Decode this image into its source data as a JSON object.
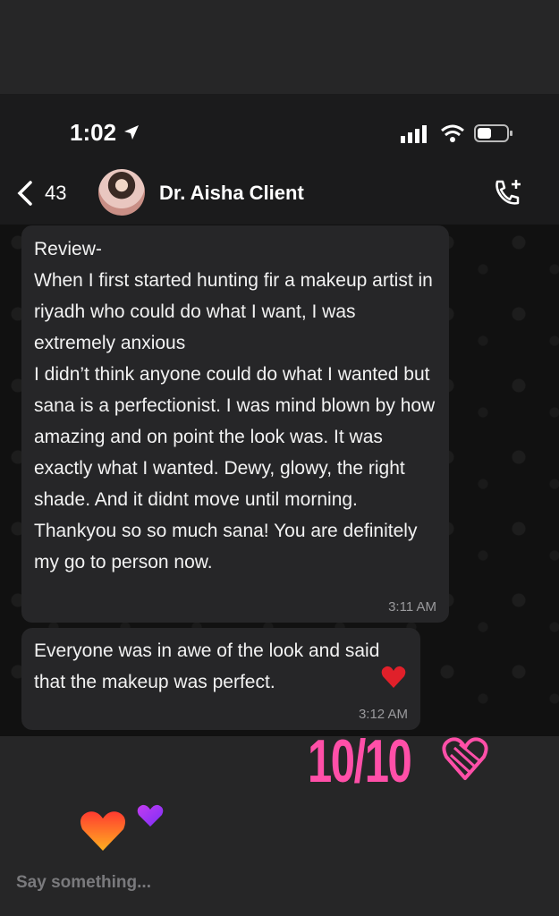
{
  "status_bar": {
    "time": "1:02"
  },
  "header": {
    "back_count": "43",
    "contact_name": "Dr. Aisha Client"
  },
  "messages": [
    {
      "text": "Review-\nWhen I first started hunting fir a makeup artist in riyadh who could do what I want, I was extremely anxious\nI didn’t think anyone could do what I wanted but sana is a perfectionist. I was mind blown by how amazing and on point the look was. It was exactly what I wanted. Dewy, glowy, the right shade. And it didnt move until morning. Thankyou so so much sana! You are definitely my go to person now.",
      "time": "3:11 AM"
    },
    {
      "text": "Everyone was in awe of the look and said that the makeup was perfect.",
      "time": "3:12 AM"
    }
  ],
  "story": {
    "score_text": "10/10",
    "reply_placeholder": "Say something..."
  },
  "colors": {
    "bubble": "#262628",
    "score_pink": "#ff4fa8",
    "heart_red": "#e0202a"
  },
  "icons": [
    "location-arrow-icon",
    "signal-icon",
    "wifi-icon",
    "battery-icon",
    "back-chevron-icon",
    "call-add-icon",
    "heart-icon"
  ]
}
